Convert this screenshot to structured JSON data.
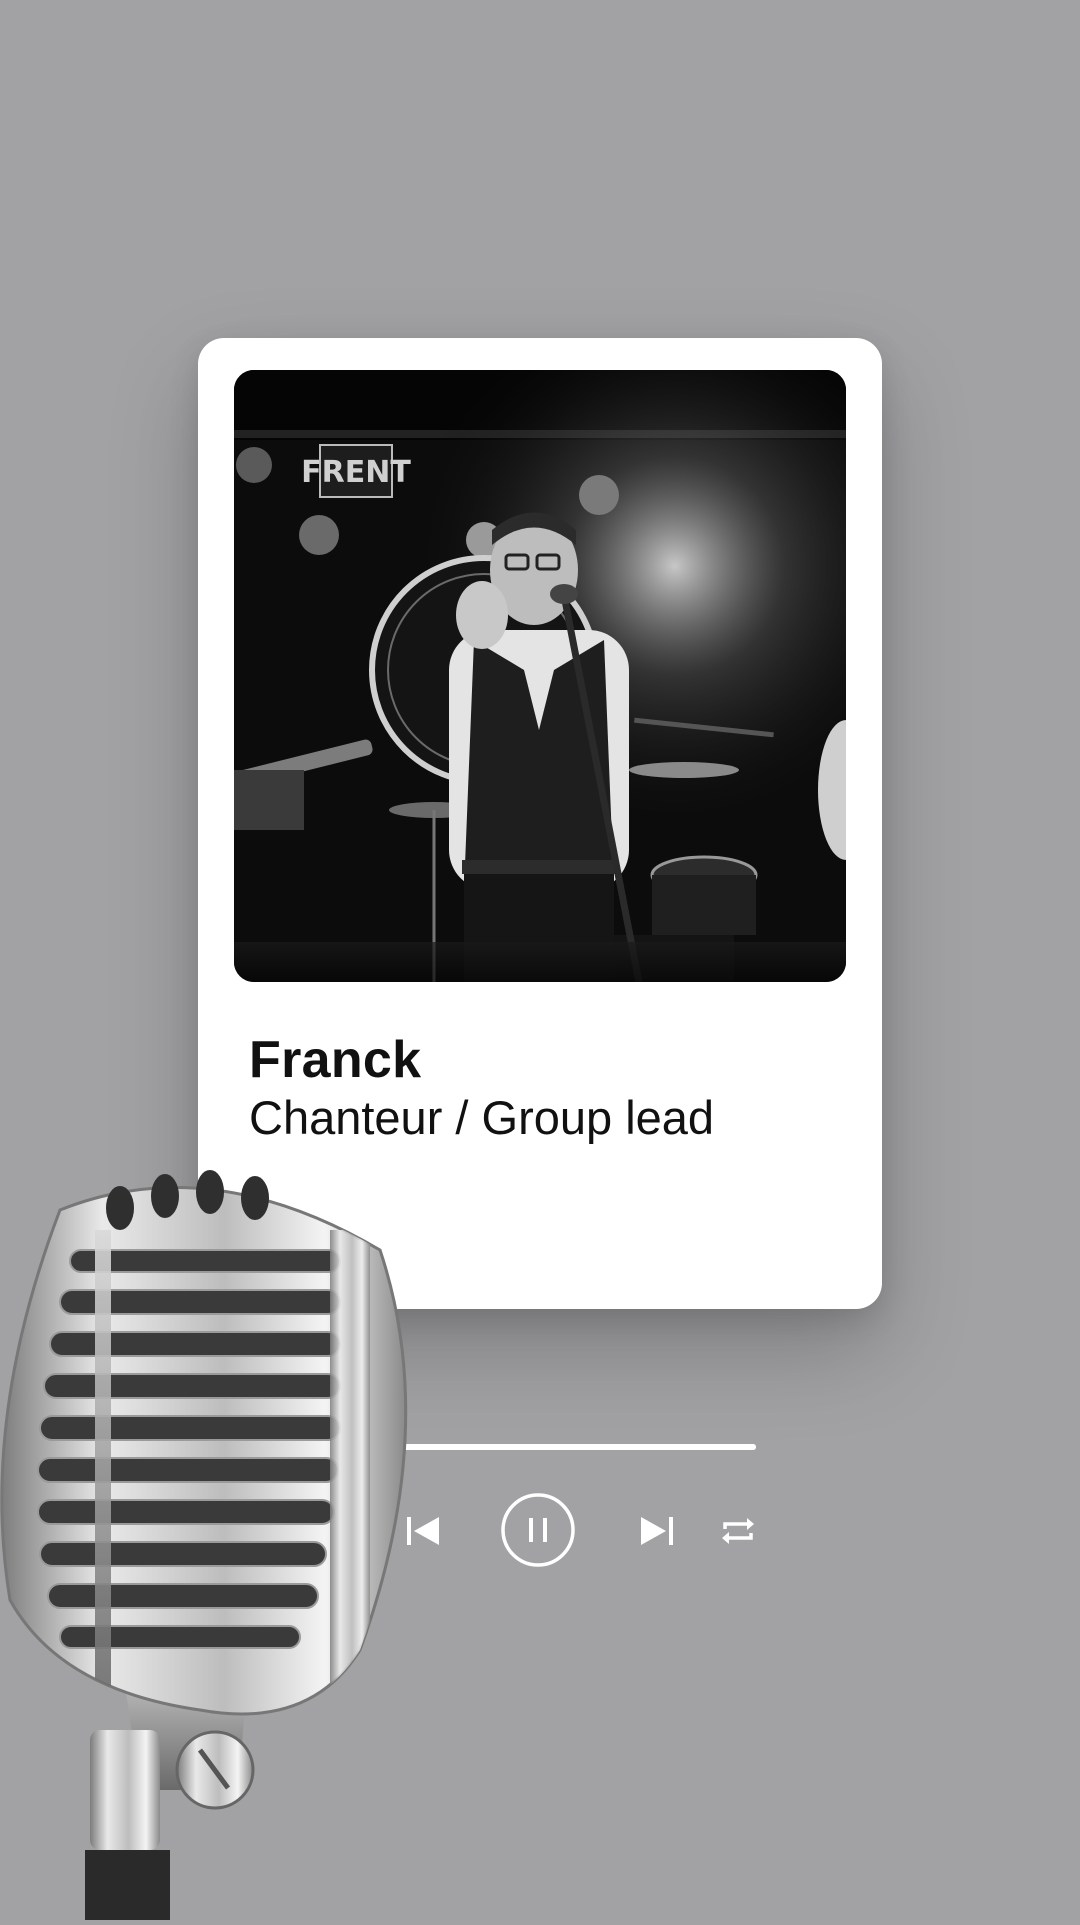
{
  "profile": {
    "name": "Franck",
    "role": "Chanteur / Group lead",
    "photo_sign_text": "FRENT"
  },
  "player": {
    "progress": 1.0,
    "state": "playing",
    "controls": {
      "previous_icon": "skip-previous-icon",
      "pause_icon": "pause-circle-icon",
      "next_icon": "skip-next-icon",
      "repeat_icon": "repeat-icon"
    }
  },
  "colors": {
    "background": "#a2a2a5",
    "card": "#ffffff",
    "text": "#111111",
    "controls": "#ffffff"
  },
  "decor": {
    "microphone": "vintage-microphone-image",
    "photo": "singer-on-stage-photo"
  }
}
